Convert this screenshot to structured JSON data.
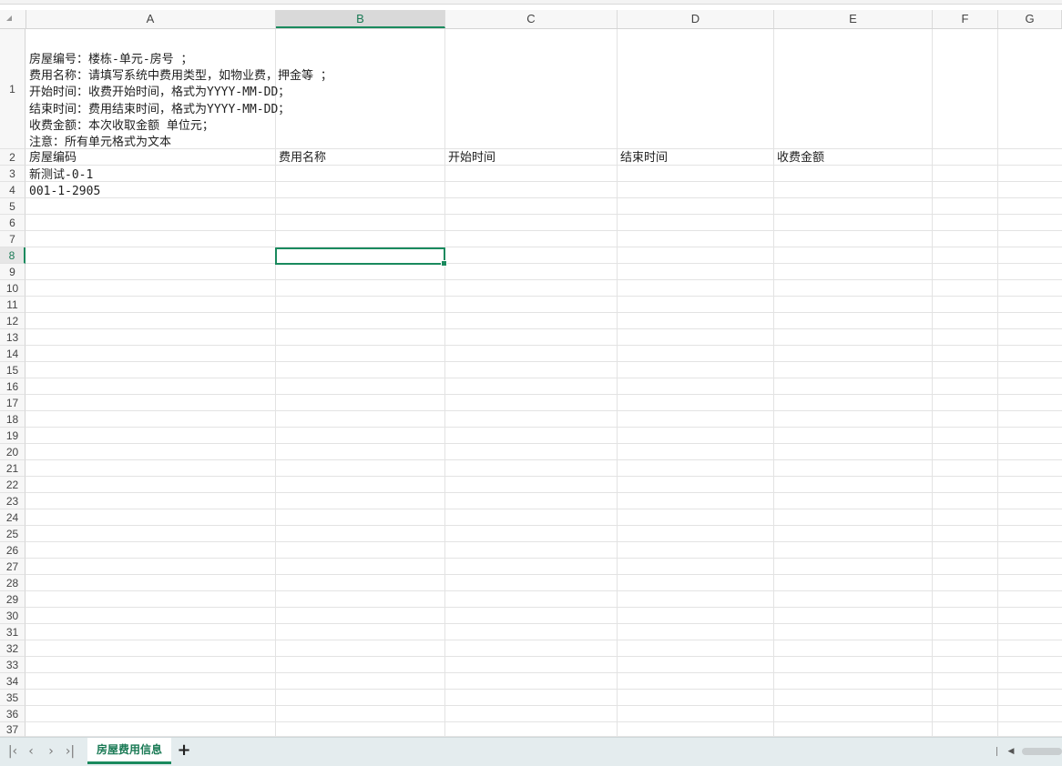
{
  "columns": [
    "A",
    "B",
    "C",
    "D",
    "E",
    "F",
    "G"
  ],
  "active_column": "B",
  "rows": [
    "1",
    "2",
    "3",
    "4",
    "5",
    "6",
    "7",
    "8",
    "9",
    "10",
    "11",
    "12",
    "13",
    "14",
    "15",
    "16",
    "17",
    "18",
    "19",
    "20",
    "21",
    "22",
    "23",
    "24",
    "25",
    "26",
    "27",
    "28",
    "29",
    "30",
    "31",
    "32",
    "33",
    "34",
    "35",
    "36",
    "37"
  ],
  "active_row": "8",
  "note_lines": [
    "房屋编号：楼栋-单元-房号 ；",
    "费用名称：请填写系统中费用类型，如物业费，押金等 ；",
    "开始时间：收费开始时间，格式为YYYY-MM-DD；",
    "结束时间：费用结束时间，格式为YYYY-MM-DD；",
    "收费金额：本次收取金额 单位元；",
    "注意：所有单元格式为文本"
  ],
  "headers": {
    "A": "房屋编码",
    "B": "费用名称",
    "C": "开始时间",
    "D": "结束时间",
    "E": "收费金额"
  },
  "data_rows": [
    {
      "A": "新测试-0-1"
    },
    {
      "A": "001-1-2905"
    }
  ],
  "sheet_tab": "房屋费用信息",
  "icons": {
    "first": "first-sheet-icon",
    "prev": "prev-sheet-icon",
    "next": "next-sheet-icon",
    "last": "last-sheet-icon",
    "add": "add-sheet-icon"
  },
  "colors": {
    "accent": "#1a8a5e",
    "tabbar": "#e4ecee"
  }
}
